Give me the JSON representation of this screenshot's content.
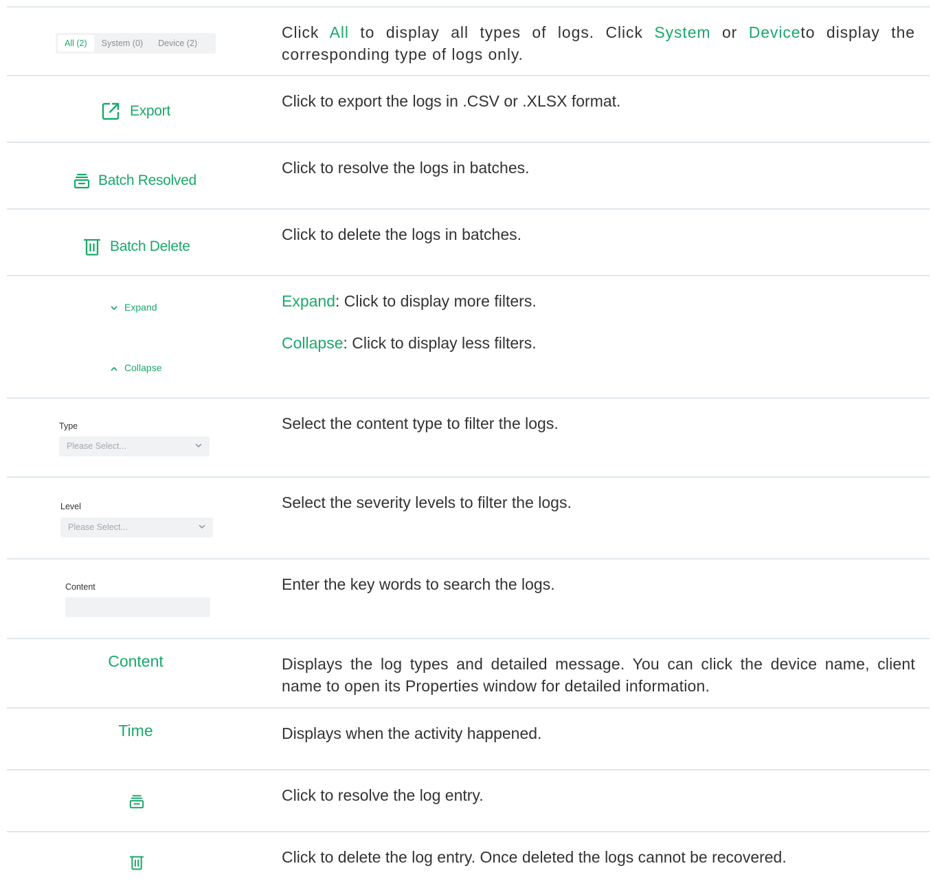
{
  "rows": {
    "tabs": {
      "all": "All (2)",
      "system": "System (0)",
      "device": "Device (2)",
      "desc_1": "Click ",
      "desc_all": "All",
      "desc_2": " to display all types of logs. Click ",
      "desc_system": "System",
      "desc_3": " or ",
      "desc_device": "Device",
      "desc_4": "to display the corresponding type of logs only."
    },
    "export": {
      "label": "Export",
      "desc": "Click to export the logs in .CSV or .XLSX format."
    },
    "batch_resolved": {
      "label": "Batch Resolved",
      "desc": "Click to resolve the logs in batches."
    },
    "batch_delete": {
      "label": "Batch Delete",
      "desc": "Click to delete the logs in batches."
    },
    "expand_collapse": {
      "expand_label": "Expand",
      "collapse_label": "Collapse",
      "expand_term": "Expand",
      "expand_desc": ": Click to display more filters.",
      "collapse_term": "Collapse",
      "collapse_desc": ": Click to display less filters."
    },
    "type_filter": {
      "label": "Type",
      "placeholder": "Please Select...",
      "desc": "Select the content type to filter the logs."
    },
    "level_filter": {
      "label": "Level",
      "placeholder": "Please Select...",
      "desc": "Select the severity levels to filter the logs."
    },
    "content_filter": {
      "label": "Content",
      "desc": "Enter the key words to search the logs."
    },
    "content_column": {
      "label": "Content",
      "desc": "Displays the log types and detailed message. You can click the device name, client name to open its Properties window for detailed information."
    },
    "time_column": {
      "label": "Time",
      "desc": "Displays when the activity happened."
    },
    "resolve_entry": {
      "desc": "Click to resolve the log entry."
    },
    "delete_entry": {
      "desc": "Click to delete the log entry. Once deleted the logs cannot be recovered."
    }
  },
  "colors": {
    "accent": "#1aa86b",
    "divider": "#dfe8ec",
    "control_bg": "#f1f2f3"
  }
}
